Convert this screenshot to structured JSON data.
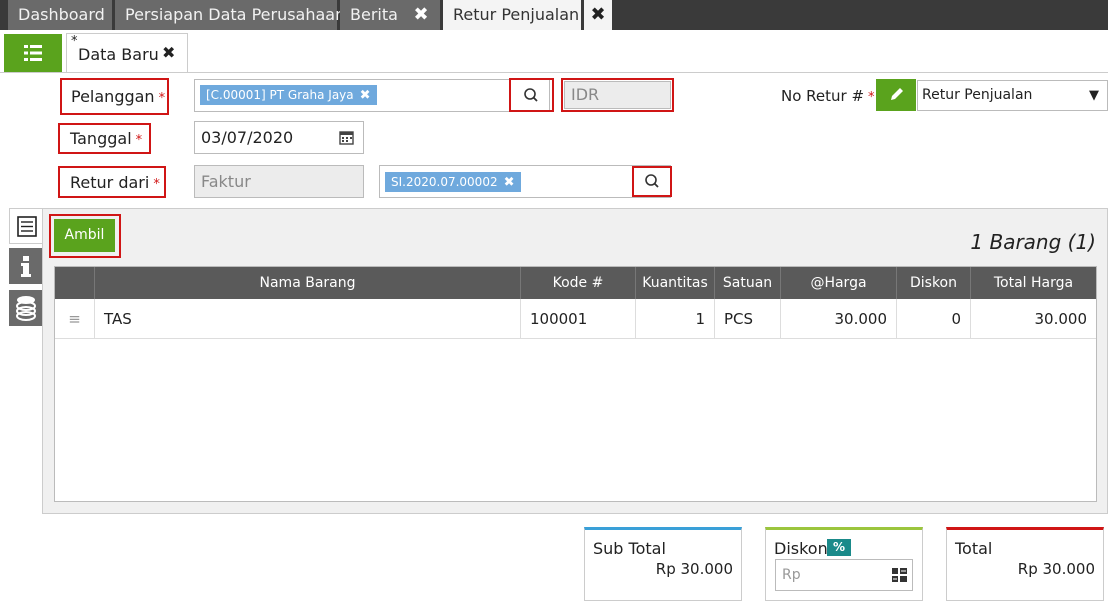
{
  "tabs": [
    {
      "label": "Dashboard"
    },
    {
      "label": "Persiapan Data Perusahaan"
    },
    {
      "label": "Berita"
    },
    {
      "label": "Retur Penjualan"
    }
  ],
  "doc_tab": {
    "label": "Data Baru",
    "modified": "*"
  },
  "form": {
    "pelanggan_label": "Pelanggan",
    "pelanggan_value": "[C.00001] PT Graha Jaya",
    "currency": "IDR",
    "tanggal_label": "Tanggal",
    "tanggal_value": "03/07/2020",
    "retur_dari_label": "Retur dari",
    "retur_dari_type": "Faktur",
    "retur_dari_value": "SI.2020.07.00002",
    "no_retur_label": "No Retur #",
    "no_retur_select": "Retur Penjualan",
    "required": "*"
  },
  "ambil_label": "Ambil",
  "item_count": "1 Barang (1)",
  "table": {
    "headers": [
      "Nama Barang",
      "Kode #",
      "Kuantitas",
      "Satuan",
      "@Harga",
      "Diskon",
      "Total Harga"
    ],
    "rows": [
      {
        "nama": "TAS",
        "kode": "100001",
        "qty": "1",
        "satuan": "PCS",
        "harga": "30.000",
        "diskon": "0",
        "total": "30.000"
      }
    ]
  },
  "totals": {
    "sub_total_label": "Sub Total",
    "sub_total_value": "Rp 30.000",
    "diskon_label": "Diskon",
    "diskon_badge": "%",
    "diskon_placeholder": "Rp",
    "total_label": "Total",
    "total_value": "Rp 30.000"
  },
  "colors": {
    "accent_green": "#5aa31d",
    "chip_blue": "#6fa9dd",
    "highlight_red": "#d01515"
  }
}
